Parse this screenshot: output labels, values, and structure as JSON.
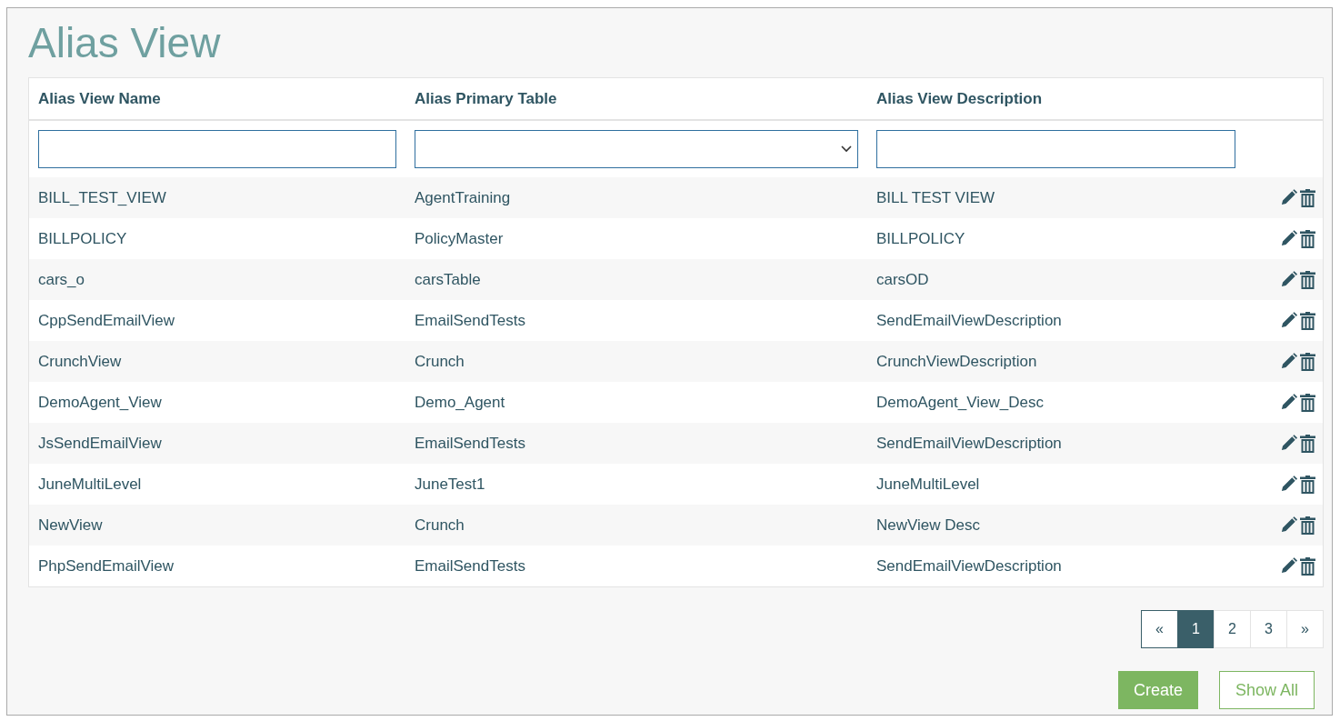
{
  "title": "Alias View",
  "table": {
    "columns": [
      "Alias View Name",
      "Alias Primary Table",
      "Alias View Description"
    ],
    "filters": [
      {
        "kind": "text"
      },
      {
        "kind": "select"
      },
      {
        "kind": "text"
      }
    ],
    "rows": [
      {
        "name": "BILL_TEST_VIEW",
        "primary_table": "AgentTraining",
        "description": "BILL TEST VIEW"
      },
      {
        "name": "BILLPOLICY",
        "primary_table": "PolicyMaster",
        "description": "BILLPOLICY"
      },
      {
        "name": "cars_o",
        "primary_table": "carsTable",
        "description": "carsOD"
      },
      {
        "name": "CppSendEmailView",
        "primary_table": "EmailSendTests",
        "description": "SendEmailViewDescription"
      },
      {
        "name": "CrunchView",
        "primary_table": "Crunch",
        "description": "CrunchViewDescription"
      },
      {
        "name": "DemoAgent_View",
        "primary_table": "Demo_Agent",
        "description": "DemoAgent_View_Desc"
      },
      {
        "name": "JsSendEmailView",
        "primary_table": "EmailSendTests",
        "description": "SendEmailViewDescription"
      },
      {
        "name": "JuneMultiLevel",
        "primary_table": "JuneTest1",
        "description": "JuneMultiLevel"
      },
      {
        "name": "NewView",
        "primary_table": "Crunch",
        "description": "NewView Desc"
      },
      {
        "name": "PhpSendEmailView",
        "primary_table": "EmailSendTests",
        "description": "SendEmailViewDescription"
      }
    ]
  },
  "pagination": [
    {
      "label": "«",
      "selected": false
    },
    {
      "label": "1",
      "selected": true
    },
    {
      "label": "2",
      "selected": false
    },
    {
      "label": "3",
      "selected": false
    },
    {
      "label": "»",
      "selected": false
    }
  ],
  "buttons": [
    {
      "label": "Create",
      "kind": "primary"
    },
    {
      "label": "Show All",
      "kind": "outline"
    }
  ]
}
